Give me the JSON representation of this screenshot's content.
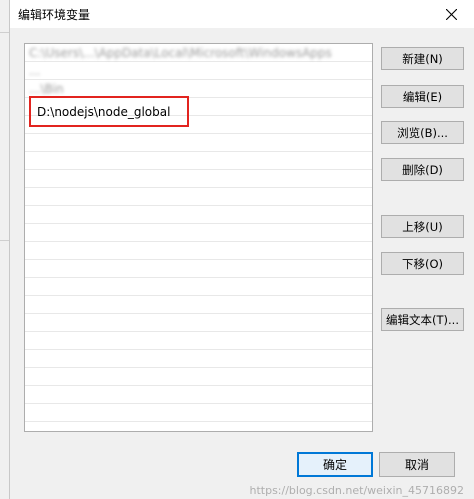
{
  "dialog": {
    "title": "编辑环境变量",
    "close_glyph": "✕"
  },
  "list": {
    "rows": [
      {
        "text": "C:\\Users\\...\\AppData\\Local\\Microsoft\\WindowsApps",
        "blurred": true
      },
      {
        "text": "...",
        "blurred": true
      },
      {
        "text": "...\\Bin",
        "blurred": true
      },
      {
        "text": "",
        "blurred": false
      }
    ],
    "selected_entry": "D:\\nodejs\\node_global"
  },
  "buttons": {
    "new": "新建(N)",
    "edit": "编辑(E)",
    "browse": "浏览(B)...",
    "delete": "删除(D)",
    "move_up": "上移(U)",
    "move_down": "下移(O)",
    "edit_text": "编辑文本(T)..."
  },
  "footer": {
    "ok": "确定",
    "cancel": "取消"
  },
  "watermark": "https://blog.csdn.net/weixin_45716892",
  "colors": {
    "highlight": "#e2241f",
    "focus": "#0078d7"
  }
}
